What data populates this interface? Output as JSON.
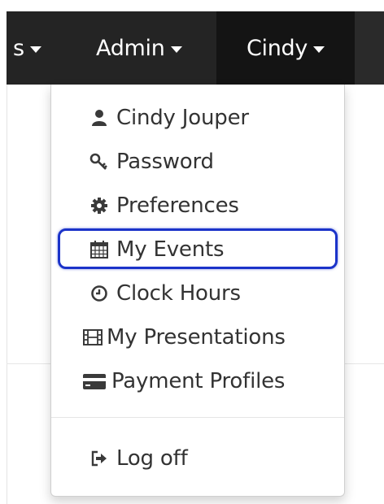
{
  "navbar": {
    "partial_label": "s",
    "admin_label": "Admin",
    "user_label": "Cindy"
  },
  "dropdown": {
    "items": [
      {
        "label": "Cindy Jouper",
        "icon": "user-icon"
      },
      {
        "label": "Password",
        "icon": "key-icon"
      },
      {
        "label": "Preferences",
        "icon": "gear-icon"
      },
      {
        "label": "My Events",
        "icon": "calendar-icon"
      },
      {
        "label": "Clock Hours",
        "icon": "clock-icon"
      },
      {
        "label": "My Presentations",
        "icon": "film-icon"
      },
      {
        "label": "Payment Profiles",
        "icon": "credit-card-icon"
      }
    ],
    "logoff": {
      "label": "Log off",
      "icon": "sign-out-icon"
    }
  },
  "colors": {
    "navbar_bg": "#242424",
    "active_nav_bg": "#141414",
    "highlight_border": "#1b33c9",
    "menu_text": "#333333"
  }
}
